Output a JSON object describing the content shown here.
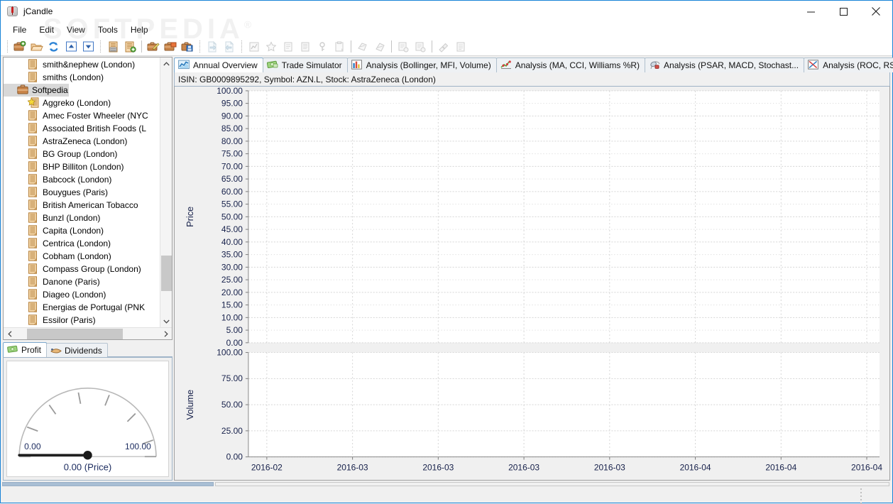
{
  "window": {
    "title": "jCandle",
    "app_icon": "candlestick-icon",
    "controls": {
      "minimize": "minimize-icon",
      "maximize": "maximize-icon",
      "close": "close-icon"
    }
  },
  "watermark": "SOFTPEDIA",
  "menubar": {
    "items": [
      {
        "label": "File"
      },
      {
        "label": "Edit"
      },
      {
        "label": "View"
      },
      {
        "label": "Tools"
      },
      {
        "label": "Help"
      }
    ]
  },
  "toolbar": {
    "groups": [
      {
        "buttons": [
          {
            "name": "new-portfolio-icon",
            "enabled": true
          },
          {
            "name": "open-portfolio-icon",
            "enabled": true
          },
          {
            "name": "refresh-icon",
            "enabled": true
          },
          {
            "name": "move-up-icon",
            "enabled": true
          },
          {
            "name": "move-down-icon",
            "enabled": true
          }
        ]
      },
      {
        "buttons": [
          {
            "name": "list-stocks-icon",
            "enabled": true
          },
          {
            "name": "add-stock-icon",
            "enabled": true
          }
        ]
      },
      {
        "buttons": [
          {
            "name": "edit-portfolio-icon",
            "enabled": true
          },
          {
            "name": "portfolio-properties-icon",
            "enabled": true
          },
          {
            "name": "save-portfolio-icon",
            "enabled": true
          }
        ]
      },
      {
        "buttons": [
          {
            "name": "import-icon",
            "enabled": false
          },
          {
            "name": "export-icon",
            "enabled": false
          }
        ]
      },
      {
        "buttons": [
          {
            "name": "chart-snapshot-icon",
            "enabled": false
          },
          {
            "name": "favorite-star-icon",
            "enabled": false
          },
          {
            "name": "notes-icon",
            "enabled": false
          },
          {
            "name": "report-icon",
            "enabled": false
          },
          {
            "name": "key-icon",
            "enabled": false
          },
          {
            "name": "clipboard-icon",
            "enabled": false
          }
        ]
      },
      {
        "buttons": [
          {
            "name": "indicator-a-icon",
            "enabled": false
          },
          {
            "name": "indicator-b-icon",
            "enabled": false
          }
        ]
      },
      {
        "buttons": [
          {
            "name": "calc-history-icon",
            "enabled": false
          },
          {
            "name": "calc-report-icon",
            "enabled": false
          }
        ]
      },
      {
        "buttons": [
          {
            "name": "clear-icon",
            "enabled": false
          },
          {
            "name": "log-icon",
            "enabled": false
          }
        ]
      }
    ]
  },
  "tree": {
    "items": [
      {
        "label": "smith&nephew (London)",
        "icon": "document-icon",
        "indent": 2,
        "selected": false
      },
      {
        "label": "smiths (London)",
        "icon": "document-icon",
        "indent": 2,
        "selected": false
      },
      {
        "label": "Softpedia",
        "icon": "briefcase-icon",
        "indent": 1,
        "selected": true
      },
      {
        "label": "Aggreko (London)",
        "icon": "starred-document-icon",
        "indent": 2,
        "selected": false
      },
      {
        "label": "Amec Foster Wheeler (NYC",
        "icon": "document-icon",
        "indent": 2,
        "selected": false
      },
      {
        "label": "Associated British Foods (L",
        "icon": "document-icon",
        "indent": 2,
        "selected": false
      },
      {
        "label": "AstraZeneca (London)",
        "icon": "document-icon",
        "indent": 2,
        "selected": false
      },
      {
        "label": "BG Group (London)",
        "icon": "document-icon",
        "indent": 2,
        "selected": false
      },
      {
        "label": "BHP Billiton (London)",
        "icon": "document-icon",
        "indent": 2,
        "selected": false
      },
      {
        "label": "Babcock (London)",
        "icon": "document-icon",
        "indent": 2,
        "selected": false
      },
      {
        "label": "Bouygues (Paris)",
        "icon": "document-icon",
        "indent": 2,
        "selected": false
      },
      {
        "label": "British American Tobacco",
        "icon": "document-icon",
        "indent": 2,
        "selected": false
      },
      {
        "label": "Bunzl (London)",
        "icon": "document-icon",
        "indent": 2,
        "selected": false
      },
      {
        "label": "Capita (London)",
        "icon": "document-icon",
        "indent": 2,
        "selected": false
      },
      {
        "label": "Centrica (London)",
        "icon": "document-icon",
        "indent": 2,
        "selected": false
      },
      {
        "label": "Cobham (London)",
        "icon": "document-icon",
        "indent": 2,
        "selected": false
      },
      {
        "label": "Compass Group (London)",
        "icon": "document-icon",
        "indent": 2,
        "selected": false
      },
      {
        "label": "Danone (Paris)",
        "icon": "document-icon",
        "indent": 2,
        "selected": false
      },
      {
        "label": "Diageo (London)",
        "icon": "document-icon",
        "indent": 2,
        "selected": false
      },
      {
        "label": "Energias de Portugal (PNK",
        "icon": "document-icon",
        "indent": 2,
        "selected": false
      },
      {
        "label": "Essilor (Paris)",
        "icon": "document-icon",
        "indent": 2,
        "selected": false
      }
    ]
  },
  "bottom_left": {
    "tabs": [
      {
        "label": "Profit",
        "icon": "money-icon",
        "active": true
      },
      {
        "label": "Dividends",
        "icon": "hand-coins-icon",
        "active": false
      }
    ],
    "gauge": {
      "min_label": "0.00",
      "max_label": "100.00",
      "value_label": "0.00 (Price)",
      "value": 0,
      "min": 0,
      "max": 100
    }
  },
  "main_tabs": [
    {
      "label": "Annual Overview",
      "icon": "line-chart-icon",
      "active": true
    },
    {
      "label": "Trade Simulator",
      "icon": "banknote-icon",
      "active": false
    },
    {
      "label": "Analysis (Bollinger, MFI, Volume)",
      "icon": "bar-chart-icon",
      "active": false
    },
    {
      "label": "Analysis (MA, CCI, Williams %R)",
      "icon": "scatter-chart-icon",
      "active": false
    },
    {
      "label": "Analysis (PSAR, MACD, Stochast...",
      "icon": "psar-chart-icon",
      "active": false
    },
    {
      "label": "Analysis (ROC, RSI, Aroon)",
      "icon": "roc-chart-icon",
      "active": false
    }
  ],
  "isin_bar": {
    "text": "ISIN: GB0009895292, Symbol: AZN.L, Stock: AstraZeneca (London)"
  },
  "chart_data": [
    {
      "type": "line",
      "title": "",
      "ylabel": "Price",
      "xlabel": "",
      "ylim": [
        0,
        100
      ],
      "ytick_labels": [
        "100.00",
        "95.00",
        "90.00",
        "85.00",
        "80.00",
        "75.00",
        "70.00",
        "65.00",
        "60.00",
        "55.00",
        "50.00",
        "45.00",
        "40.00",
        "35.00",
        "30.00",
        "25.00",
        "20.00",
        "15.00",
        "10.00",
        "5.00",
        "0.00"
      ],
      "ytick_values": [
        100,
        95,
        90,
        85,
        80,
        75,
        70,
        65,
        60,
        55,
        50,
        45,
        40,
        35,
        30,
        25,
        20,
        15,
        10,
        5,
        0
      ],
      "xtick_labels": [
        "2016-02",
        "2016-03",
        "2016-03",
        "2016-03",
        "2016-03",
        "2016-04",
        "2016-04",
        "2016-04"
      ],
      "series": [
        {
          "name": "Price",
          "values": []
        }
      ],
      "grid": true,
      "legend": "none"
    },
    {
      "type": "bar",
      "title": "",
      "ylabel": "Volume",
      "xlabel": "",
      "ylim": [
        0,
        100
      ],
      "ytick_labels": [
        "100.00",
        "75.00",
        "50.00",
        "25.00",
        "0.00"
      ],
      "ytick_values": [
        100,
        75,
        50,
        25,
        0
      ],
      "xtick_labels": [
        "2016-02",
        "2016-03",
        "2016-03",
        "2016-03",
        "2016-03",
        "2016-04",
        "2016-04",
        "2016-04"
      ],
      "series": [
        {
          "name": "Volume",
          "values": []
        }
      ],
      "grid": true,
      "legend": "none"
    }
  ],
  "colors": {
    "window_border": "#1883d7",
    "tab_active_border": "#7aa7cc",
    "selection": "#d8d8d8",
    "gridline": "#d5d5d5",
    "plot_bg": "#ffffff",
    "panel_bg": "#f0f0f0",
    "status_progress": "#a8bed4"
  },
  "statusbar": {
    "text": ""
  }
}
